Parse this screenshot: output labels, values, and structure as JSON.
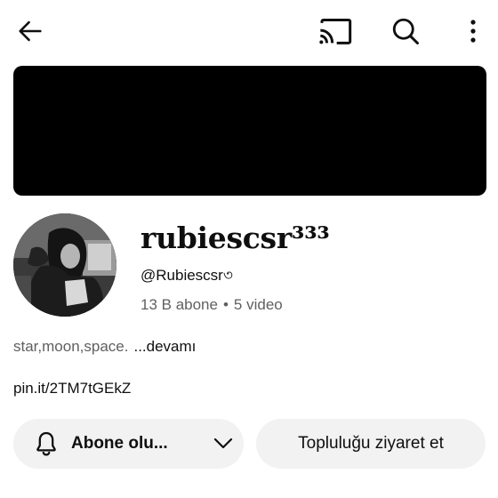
{
  "header": {
    "back_icon": "arrow-left-icon",
    "cast_icon": "cast-icon",
    "search_icon": "search-icon",
    "more_icon": "more-vertical-icon"
  },
  "channel": {
    "name": "rubiescsr³³³",
    "handle": "@Rubiescsr৩",
    "subscribers": "13 B abone",
    "separator": "•",
    "videos": "5 video",
    "description": "star,moon,space.",
    "more_label": "...devamı",
    "link": "pin.it/2TM7tGEkZ"
  },
  "actions": {
    "subscribe_label": "Abone olu...",
    "subscribe_icon": "bell-icon",
    "dropdown_icon": "chevron-down-icon",
    "community_label": "Topluluğu ziyaret et"
  },
  "colors": {
    "banner": "#000000",
    "button_bg": "#f2f2f2",
    "secondary_text": "#606060",
    "primary_text": "#0f0f0f"
  }
}
